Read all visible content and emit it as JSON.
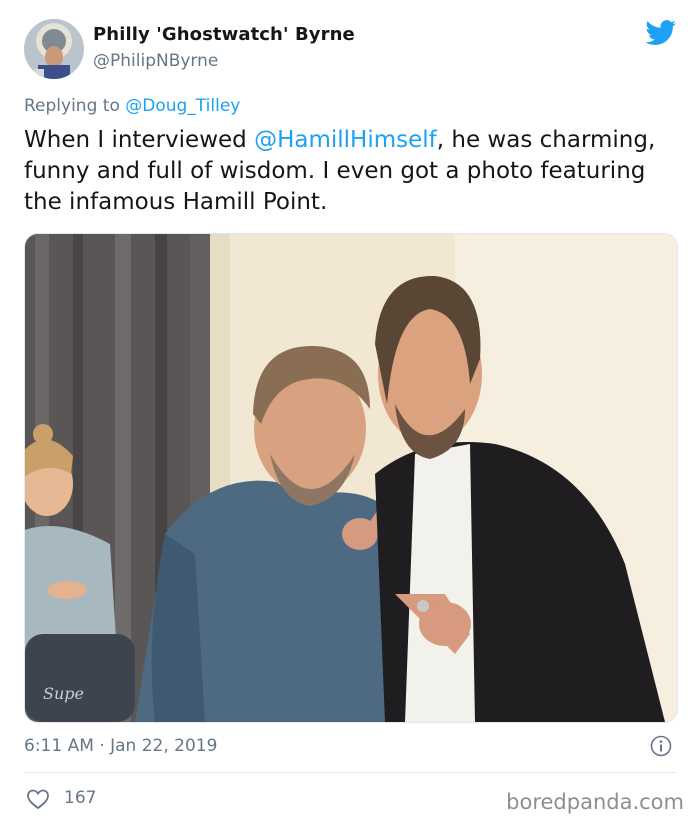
{
  "author": {
    "display_name": "Philly 'Ghostwatch' Byrne",
    "handle": "@PhilipNByrne"
  },
  "reply": {
    "prefix": "Replying to ",
    "to_handle": "@Doug_Tilley"
  },
  "tweet": {
    "text_before": "When I interviewed ",
    "mention": "@HamillHimself",
    "text_after": ", he was charming, funny and full of wisdom. I even got a photo featuring the infamous Hamill Point."
  },
  "meta": {
    "timestamp": "6:11 AM · Jan 22, 2019",
    "likes": "167"
  },
  "icons": {
    "brand": "twitter-bird-icon",
    "info": "info-icon",
    "like": "heart-icon"
  },
  "watermark": "boredpanda.com",
  "colors": {
    "accent": "#1da1f2",
    "text": "#14171a",
    "muted": "#657786"
  }
}
